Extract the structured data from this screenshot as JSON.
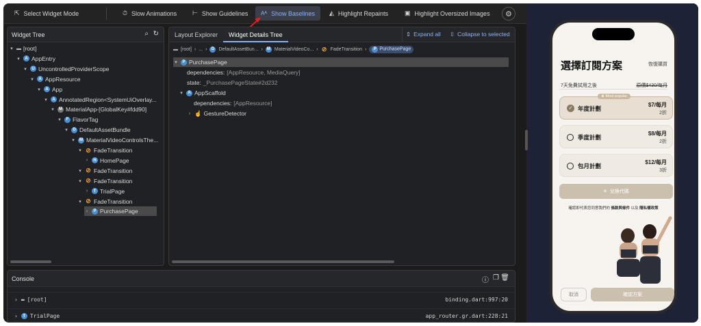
{
  "toolbar": {
    "select_widget_mode": "Select Widget Mode",
    "slow_animations": "Slow Animations",
    "show_guidelines": "Show Guidelines",
    "show_baselines": "Show Baselines",
    "highlight_repaints": "Highlight Repaints",
    "highlight_oversized": "Highlight Oversized Images"
  },
  "widget_tree": {
    "title": "Widget Tree",
    "rows": [
      {
        "label": "[root]",
        "badge": "",
        "indent": 0
      },
      {
        "label": "AppEntry",
        "badge": "A",
        "indent": 1
      },
      {
        "label": "UncontrolledProviderScope",
        "badge": "U",
        "indent": 2
      },
      {
        "label": "AppResource",
        "badge": "A",
        "indent": 3
      },
      {
        "label": "App",
        "badge": "A",
        "indent": 4
      },
      {
        "label": "AnnotatedRegion<SystemUiOverlay...",
        "badge": "A",
        "indent": 5
      },
      {
        "label": "MaterialApp-[GlobalKey#fdd90]",
        "badge": "M",
        "indent": 6
      },
      {
        "label": "FlavorTag",
        "badge": "F",
        "indent": 7
      },
      {
        "label": "DefaultAssetBundle",
        "badge": "D",
        "indent": 8
      },
      {
        "label": "MaterialVideoControlsThe...",
        "badge": "M",
        "indent": 9
      },
      {
        "label": "FadeTransition",
        "badge": "anim",
        "indent": 10
      },
      {
        "label": "HomePage",
        "badge": "H",
        "indent": 11
      },
      {
        "label": "FadeTransition",
        "badge": "anim",
        "indent": 10
      },
      {
        "label": "FadeTransition",
        "badge": "anim",
        "indent": 10
      },
      {
        "label": "TrialPage",
        "badge": "T",
        "indent": 11
      },
      {
        "label": "FadeTransition",
        "badge": "anim",
        "indent": 10
      },
      {
        "label": "PurchasePage",
        "badge": "P",
        "indent": 11
      }
    ]
  },
  "details": {
    "tab_layout": "Layout Explorer",
    "tab_details": "Widget Details Tree",
    "expand_all": "Expand all",
    "collapse": "Collapse to selected",
    "crumbs": [
      "[root]",
      "...",
      "DefaultAssetBun...",
      "MaterialVideoCo...",
      "FadeTransition",
      "PurchasePage"
    ],
    "root_label": "PurchasePage",
    "deps_key": "dependencies:",
    "deps_val": "[AppResource, MediaQuery]",
    "state_key": "state:",
    "state_val": "_PurchasePageState#2d232",
    "scaffold": "AppScaffold",
    "deps2_key": "dependencies:",
    "deps2_val": "[AppResource]",
    "gesture": "GestureDetector"
  },
  "console": {
    "title": "Console",
    "rows": [
      {
        "label": "[root]",
        "source": "binding.dart:997:20"
      },
      {
        "label": "TrialPage",
        "source": "app_router.gr.dart:228:21"
      }
    ]
  },
  "phone": {
    "title": "選擇訂閱方案",
    "restore": "恢復購買",
    "trial": "7天免費試用之後",
    "original_price": "原價$430/每月",
    "most_popular": "Most popular",
    "plans": [
      {
        "name": "年度計劃",
        "price": "$7/每月",
        "discount": "2折",
        "selected": true
      },
      {
        "name": "季度計劃",
        "price": "$8/每月",
        "discount": "2折",
        "selected": false
      },
      {
        "name": "包月計劃",
        "price": "$12/每月",
        "discount": "3折",
        "selected": false
      }
    ],
    "redeem": "兌換代碼",
    "terms_prefix": "確認即代表您同意我們的",
    "terms_link": "條款與條件",
    "terms_and": "以及",
    "privacy_link": "隱私權政策",
    "cancel": "取消",
    "confirm": "確認方案"
  }
}
